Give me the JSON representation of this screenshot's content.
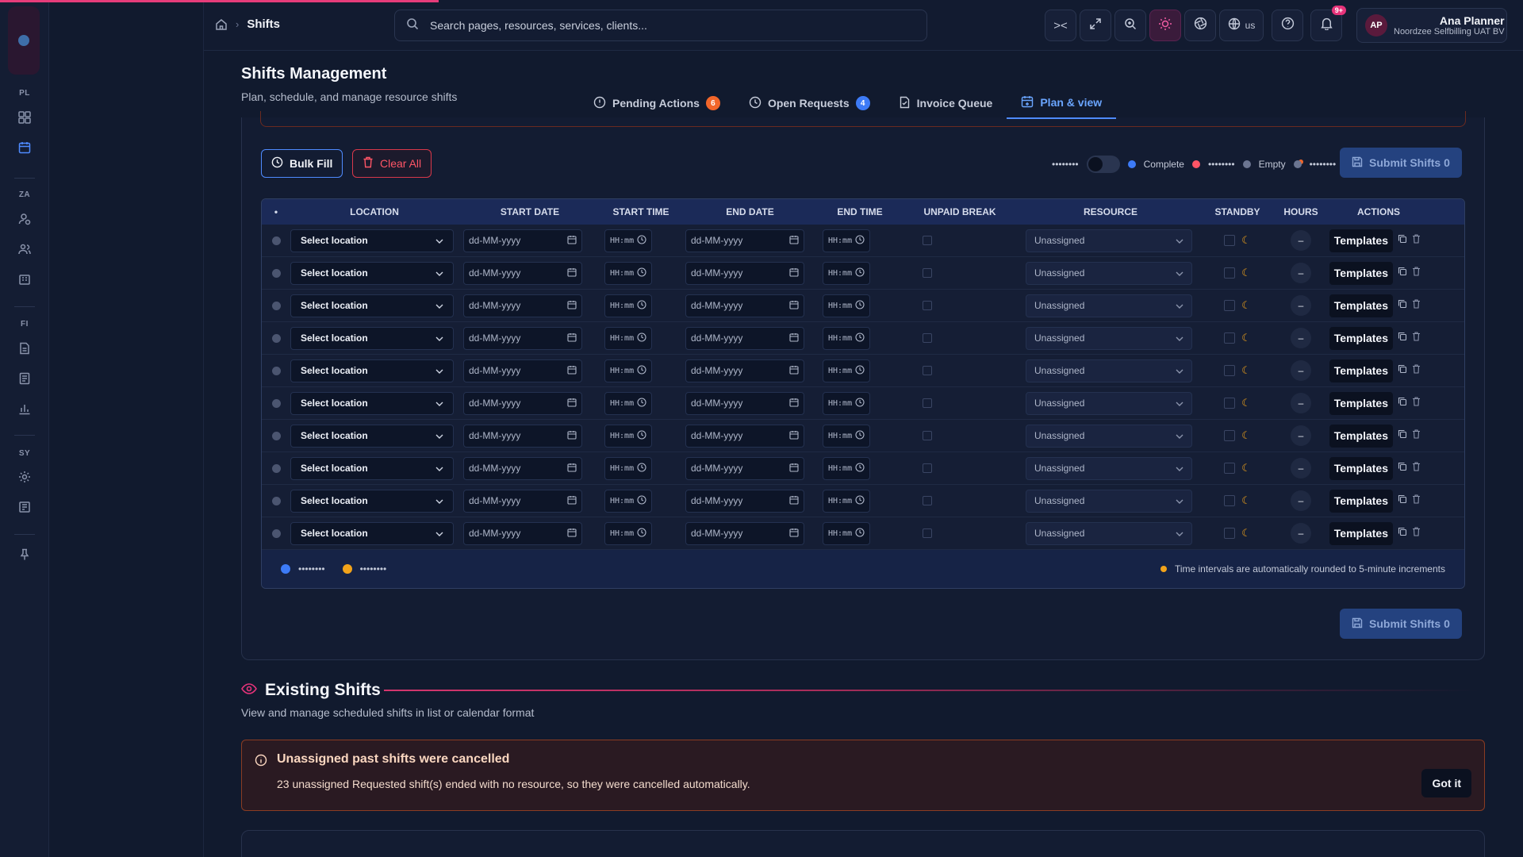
{
  "topbar": {
    "breadcrumb_current": "Shifts",
    "search_placeholder": "Search pages, resources, services, clients...",
    "lang": "us",
    "notif_badge": "9+",
    "user_name": "Ana Planner",
    "user_org": "Noordzee Selfbilling UAT BV",
    "user_initials": "AP"
  },
  "rail": {
    "sections": [
      "PL",
      "ZA",
      "FI",
      "SY"
    ]
  },
  "page": {
    "title": "Shifts Management",
    "subtitle": "Plan, schedule, and manage resource shifts",
    "tabs": [
      {
        "label": "Pending Actions",
        "count": "6"
      },
      {
        "label": "Open Requests",
        "count": "4"
      },
      {
        "label": "Invoice Queue",
        "count": ""
      },
      {
        "label": "Plan & view",
        "count": ""
      }
    ]
  },
  "toolbar": {
    "bulk_fill": "Bulk Fill",
    "clear_all": "Clear All",
    "legend_hidden": "••••••••",
    "legend_complete": "Complete",
    "legend_empty": "Empty",
    "submit": "Submit Shifts 0"
  },
  "table": {
    "headers": [
      "•",
      "LOCATION",
      "START DATE",
      "START TIME",
      "END DATE",
      "END TIME",
      "UNPAID BREAK",
      "RESOURCE",
      "STANDBY",
      "HOURS",
      "ACTIONS"
    ],
    "row_defaults": {
      "location": "Select location",
      "date": "dd-MM-yyyy",
      "time": "HH:mm",
      "resource": "Unassigned",
      "hours": "–",
      "templates": "Templates"
    },
    "row_count": 10,
    "footer_legend_1": "••••••••",
    "footer_legend_2": "••••••••",
    "footer_note": "Time intervals are automatically rounded to 5-minute increments"
  },
  "existing": {
    "title": "Existing Shifts",
    "subtitle": "View and manage scheduled shifts in list or calendar format",
    "alert_title": "Unassigned past shifts were cancelled",
    "alert_msg": "23 unassigned Requested shift(s) ended with no resource, so they were cancelled automatically.",
    "alert_button": "Got it"
  },
  "colors": {
    "accent": "#4f8bff",
    "brand_pink": "#e63c7a",
    "danger": "#ff5566",
    "orange": "#f2662a"
  }
}
